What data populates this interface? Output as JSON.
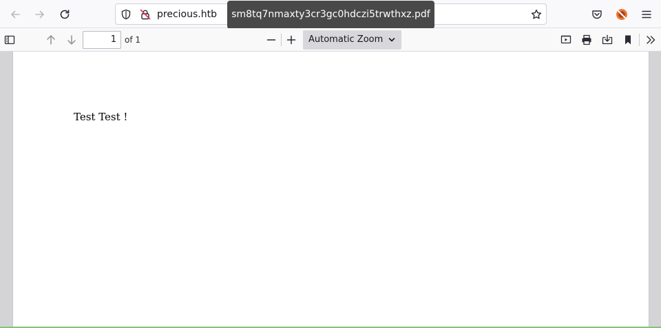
{
  "browser": {
    "url_text": "precious.htb",
    "tooltip_text": "sm8tq7nmaxty3cr3gc0hdczi5trwthxz.pdf",
    "icons": {
      "back": "back-arrow-icon",
      "forward": "forward-arrow-icon",
      "reload": "reload-icon",
      "tracking": "shield-icon",
      "insecure": "insecure-lock-icon",
      "bookmark": "star-icon",
      "pocket": "pocket-icon",
      "extension": "extension-icon",
      "menu": "hamburger-menu-icon"
    }
  },
  "pdf_toolbar": {
    "page_number": "1",
    "page_of": "of 1",
    "zoom_label": "Automatic Zoom",
    "icons": {
      "sidebar": "sidebar-toggle-icon",
      "previous": "arrow-up-icon",
      "next": "arrow-down-icon",
      "zoom_out": "minus-icon",
      "zoom_in": "plus-icon",
      "presentation": "presentation-mode-icon",
      "print": "print-icon",
      "save": "download-icon",
      "bookmark": "bookmark-icon",
      "tools": "double-chevron-icon"
    }
  },
  "document": {
    "content_text": "Test Test !"
  },
  "colors": {
    "tooltip_bg": "#494949",
    "viewer_bg": "#d4d4d7",
    "zoom_bg": "#d8d8dc",
    "status_line": "#86c17d"
  }
}
